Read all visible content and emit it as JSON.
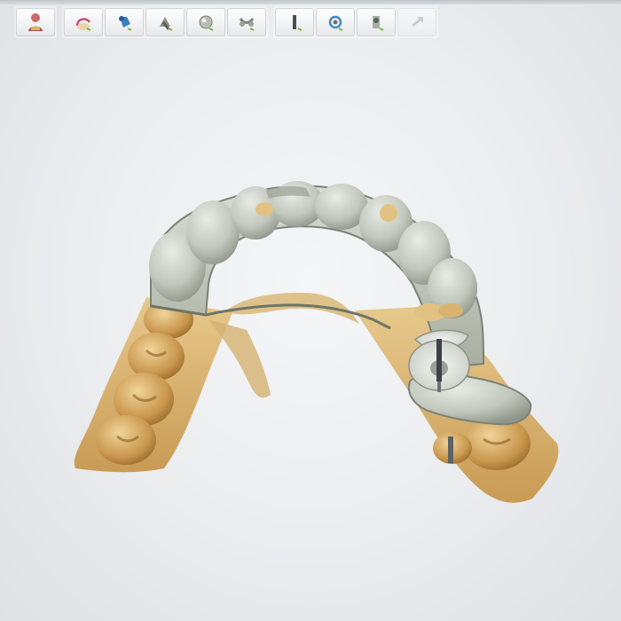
{
  "window": {
    "background": "#eceef0"
  },
  "toolbar": {
    "groups": [
      {
        "tools": [
          {
            "icon": "patient-model-icon",
            "enabled": true
          }
        ]
      },
      {
        "tools": [
          {
            "icon": "margin-line-icon",
            "enabled": true
          },
          {
            "icon": "insertion-direction-icon",
            "enabled": true
          },
          {
            "icon": "adapt-tool-icon",
            "enabled": true
          },
          {
            "icon": "sculpt-ball-icon",
            "enabled": true
          },
          {
            "icon": "connector-icon",
            "enabled": true
          }
        ]
      },
      {
        "tools": [
          {
            "icon": "screw-channel-icon",
            "enabled": true
          },
          {
            "icon": "rotate-view-icon",
            "enabled": true,
            "active": true
          },
          {
            "icon": "finalize-icon",
            "enabled": true
          },
          {
            "icon": "export-icon",
            "enabled": false
          }
        ]
      }
    ]
  },
  "model": {
    "restoration_color": "#c7ccc3",
    "scan_color": "#d8b479",
    "abutment_color": "#e0c07e",
    "screw_channel_color": "#e9ebe6"
  }
}
